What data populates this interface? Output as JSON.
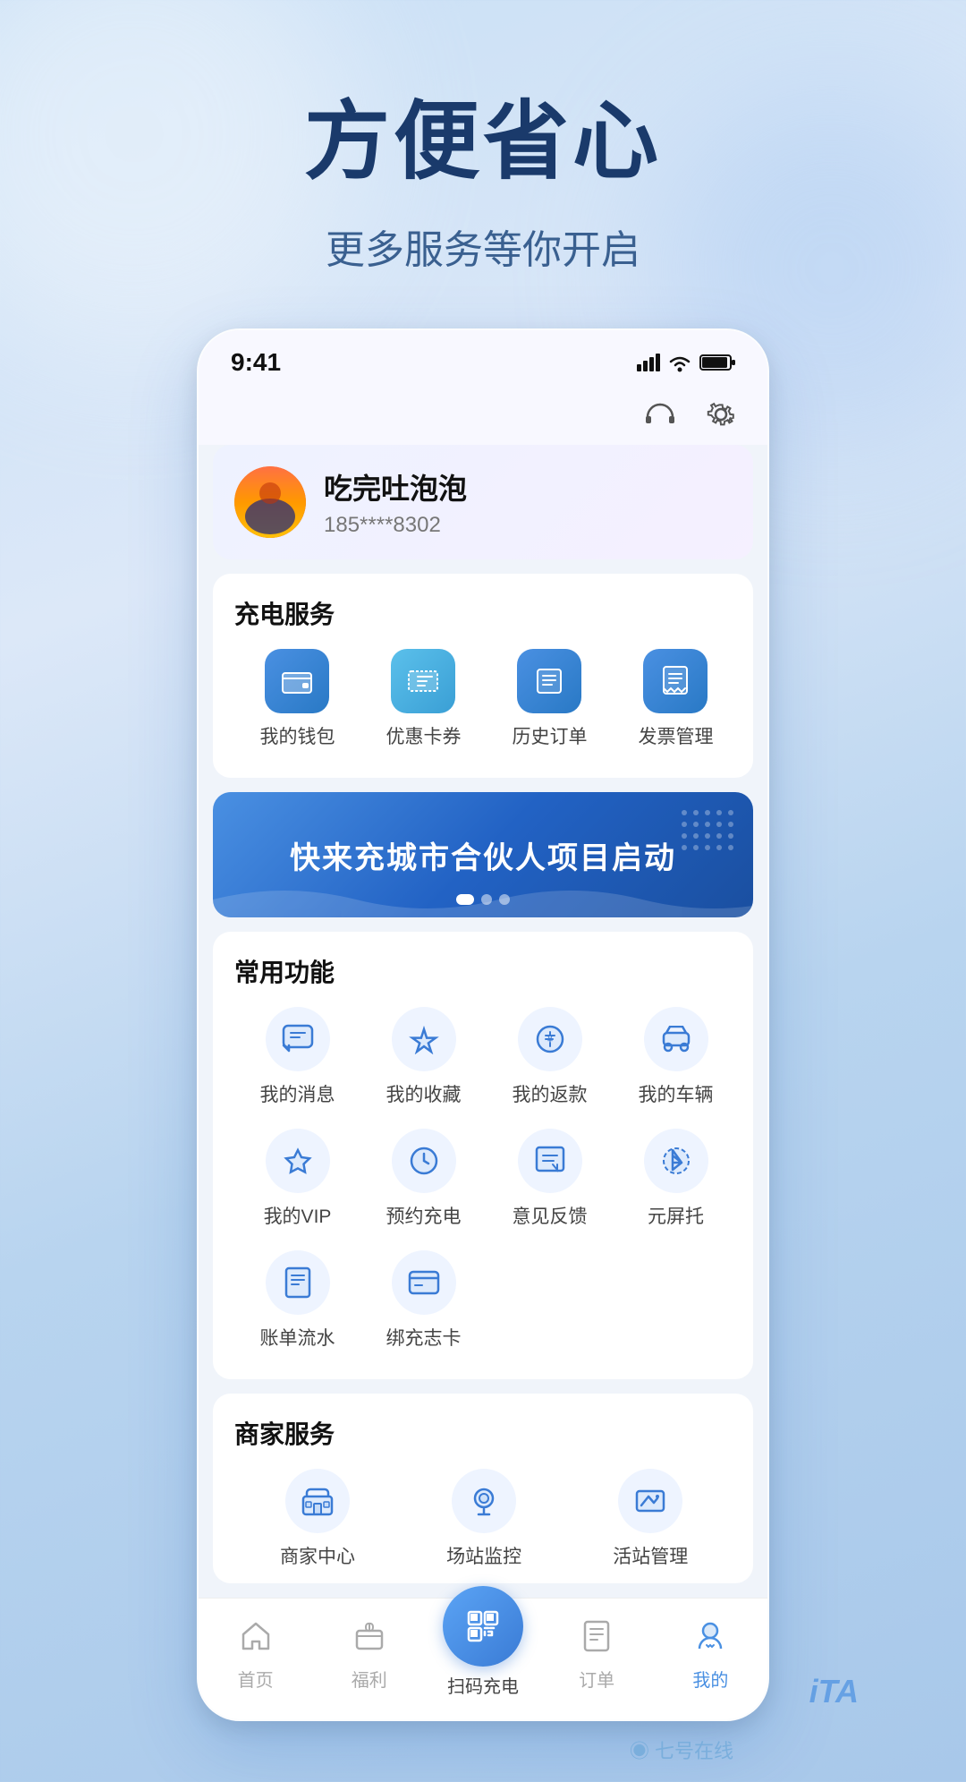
{
  "page": {
    "hero_title": "方便省心",
    "hero_subtitle": "更多服务等你开启"
  },
  "status_bar": {
    "time": "9:41"
  },
  "profile": {
    "name": "吃完吐泡泡",
    "phone": "185****8302"
  },
  "charging_section": {
    "title": "充电服务",
    "items": [
      {
        "label": "我的钱包",
        "icon": "💳"
      },
      {
        "label": "优惠卡券",
        "icon": "🎫"
      },
      {
        "label": "历史订单",
        "icon": "📋"
      },
      {
        "label": "发票管理",
        "icon": "🧾"
      }
    ]
  },
  "banner": {
    "text": "快来充城市合伙人项目启动",
    "dots": [
      true,
      false,
      false
    ]
  },
  "common_section": {
    "title": "常用功能",
    "items": [
      {
        "label": "我的消息",
        "icon": "💬"
      },
      {
        "label": "我的收藏",
        "icon": "⭐"
      },
      {
        "label": "我的返款",
        "icon": "💰"
      },
      {
        "label": "我的车辆",
        "icon": "🚗"
      },
      {
        "label": "我的VIP",
        "icon": "♦"
      },
      {
        "label": "预约充电",
        "icon": "⏰"
      },
      {
        "label": "意见反馈",
        "icon": "✏️"
      },
      {
        "label": "元屏托",
        "icon": "📡"
      },
      {
        "label": "账单流水",
        "icon": "📄"
      },
      {
        "label": "绑充志卡",
        "icon": "💳"
      }
    ]
  },
  "merchant_section": {
    "title": "商家服务",
    "items": [
      {
        "label": "商家中心",
        "icon": "🏪"
      },
      {
        "label": "场站监控",
        "icon": "📷"
      },
      {
        "label": "活站管理",
        "icon": "📈"
      }
    ]
  },
  "bottom_nav": {
    "items": [
      {
        "label": "首页",
        "icon": "🏠",
        "active": false
      },
      {
        "label": "福利",
        "icon": "🎁",
        "active": false
      },
      {
        "label": "扫码充电",
        "icon": "⊡",
        "scan": true,
        "active": false
      },
      {
        "label": "订单",
        "icon": "📋",
        "active": false
      },
      {
        "label": "我的",
        "icon": "⚡",
        "active": true
      }
    ]
  },
  "watermark": {
    "text": "◉ 七号在线",
    "ita": "iTA"
  }
}
